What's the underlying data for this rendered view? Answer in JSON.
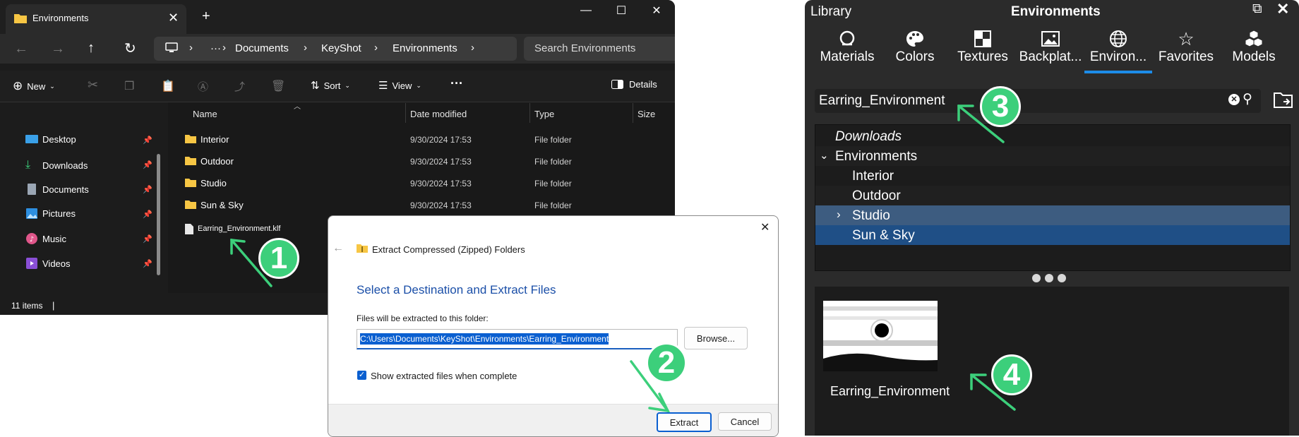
{
  "explorer": {
    "tab_title": "Environments",
    "address": {
      "crumbs": [
        "Documents",
        "KeyShot",
        "Environments"
      ],
      "ellipsis": "···"
    },
    "search_placeholder": "Search Environments",
    "toolbar": {
      "new_label": "New",
      "sort_label": "Sort",
      "view_label": "View",
      "more_label": "···",
      "details_label": "Details"
    },
    "nav_items": [
      {
        "label": "Desktop",
        "icon": "desktop-icon"
      },
      {
        "label": "Downloads",
        "icon": "download-icon"
      },
      {
        "label": "Documents",
        "icon": "document-icon"
      },
      {
        "label": "Pictures",
        "icon": "pictures-icon"
      },
      {
        "label": "Music",
        "icon": "music-icon"
      },
      {
        "label": "Videos",
        "icon": "video-icon"
      }
    ],
    "columns": [
      "Name",
      "Date modified",
      "Type",
      "Size"
    ],
    "rows": [
      {
        "name": "Interior",
        "date": "9/30/2024 17:53",
        "type": "File folder"
      },
      {
        "name": "Outdoor",
        "date": "9/30/2024 17:53",
        "type": "File folder"
      },
      {
        "name": "Studio",
        "date": "9/30/2024 17:53",
        "type": "File folder"
      },
      {
        "name": "Sun & Sky",
        "date": "9/30/2024 17:53",
        "type": "File folder"
      }
    ],
    "file_item": "Earring_Environment.klf",
    "status": "11 items",
    "status_sep": "|"
  },
  "dialog": {
    "title": "Extract Compressed (Zipped) Folders",
    "heading": "Select a Destination and Extract Files",
    "label": "Files will be extracted to this folder:",
    "path": "C:\\Users\\Documents\\KeyShot\\Environments\\Earring_Environment",
    "browse_label": "Browse...",
    "checkbox_label": "Show extracted files when complete",
    "checkbox_checked": true,
    "extract_label": "Extract",
    "cancel_label": "Cancel"
  },
  "keyshot": {
    "library_label": "Library",
    "panel_title": "Environments",
    "tabs": [
      {
        "label": "Materials",
        "icon": "materials-icon"
      },
      {
        "label": "Colors",
        "icon": "palette-icon"
      },
      {
        "label": "Textures",
        "icon": "textures-icon"
      },
      {
        "label": "Backplat...",
        "icon": "image-icon"
      },
      {
        "label": "Environ...",
        "icon": "globe-icon",
        "active": true
      },
      {
        "label": "Favorites",
        "icon": "star-icon"
      },
      {
        "label": "Models",
        "icon": "cubes-icon"
      }
    ],
    "search_value": "Earring_Environment",
    "tree": {
      "downloads": "Downloads",
      "environments": "Environments",
      "children": [
        "Interior",
        "Outdoor",
        "Studio",
        "Sun & Sky"
      ]
    },
    "thumbnail_label": "Earring_Environment",
    "accent_color": "#1d8ce8"
  },
  "callouts": [
    "1",
    "2",
    "3",
    "4"
  ],
  "colors": {
    "callout_green": "#3ccf7b"
  }
}
